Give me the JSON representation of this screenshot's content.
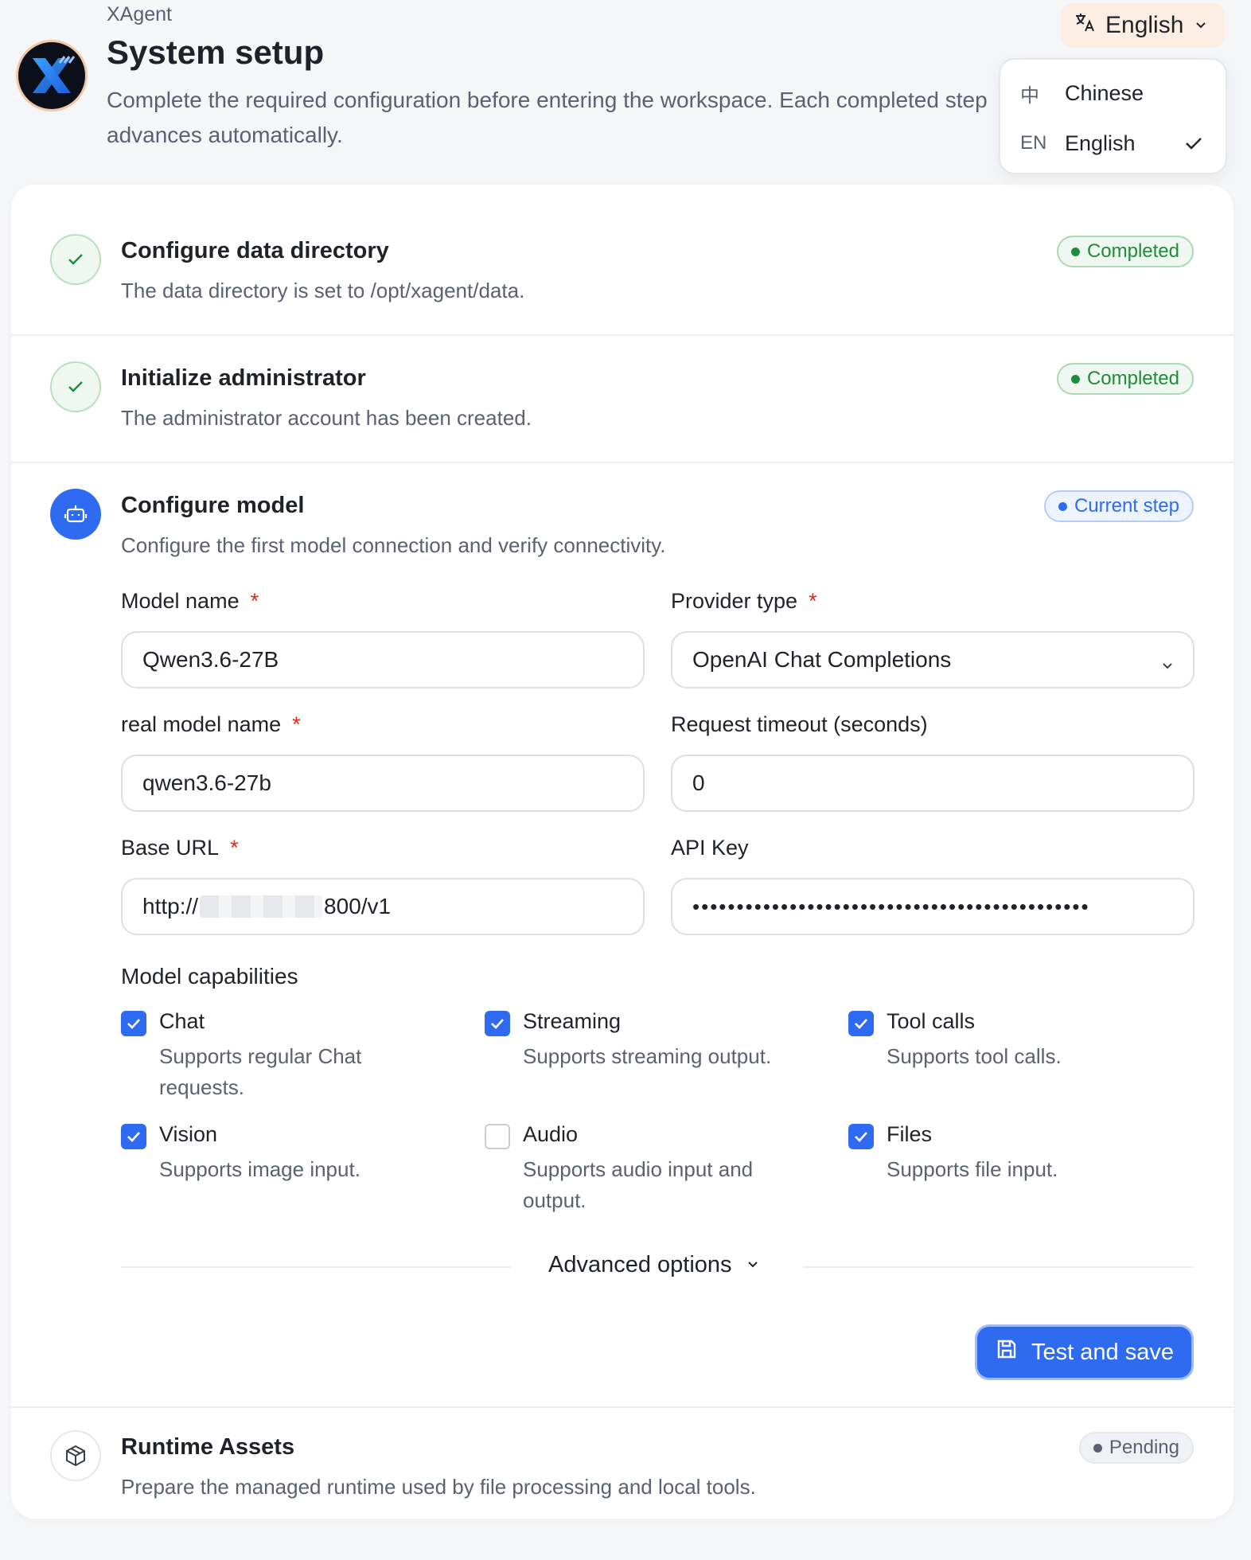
{
  "header": {
    "app_name": "XAgent",
    "title": "System setup",
    "subtitle": "Complete the required configuration before entering the workspace. Each completed step advances automatically."
  },
  "language": {
    "current": "English",
    "options": [
      {
        "code": "中",
        "name": "Chinese",
        "selected": false
      },
      {
        "code": "EN",
        "name": "English",
        "selected": true
      }
    ]
  },
  "steps": {
    "data_dir": {
      "title": "Configure data directory",
      "desc": "The data directory is set to /opt/xagent/data.",
      "status": "Completed"
    },
    "admin": {
      "title": "Initialize administrator",
      "desc": "The administrator account has been created.",
      "status": "Completed"
    },
    "model": {
      "title": "Configure model",
      "desc": "Configure the first model connection and verify connectivity.",
      "status": "Current step"
    },
    "runtime": {
      "title": "Runtime Assets",
      "desc": "Prepare the managed runtime used by file processing and local tools.",
      "status": "Pending"
    }
  },
  "form": {
    "model_name": {
      "label": "Model name",
      "value": "Qwen3.6-27B",
      "required": "*"
    },
    "provider_type": {
      "label": "Provider type",
      "value": "OpenAI Chat Completions",
      "required": "*"
    },
    "real_model_name": {
      "label": "real model name",
      "value": "qwen3.6-27b",
      "required": "*"
    },
    "timeout": {
      "label": "Request timeout (seconds)",
      "value": "0"
    },
    "base_url": {
      "label": "Base URL",
      "prefix": "http://",
      "suffix": "800/v1",
      "required": "*"
    },
    "api_key": {
      "label": "API Key",
      "value": "•••••••••••••••••••••••••••••••••••••••••••••"
    }
  },
  "capabilities": {
    "title": "Model capabilities",
    "items": [
      {
        "label": "Chat",
        "desc": "Supports regular Chat requests.",
        "checked": true
      },
      {
        "label": "Streaming",
        "desc": "Supports streaming output.",
        "checked": true
      },
      {
        "label": "Tool calls",
        "desc": "Supports tool calls.",
        "checked": true
      },
      {
        "label": "Vision",
        "desc": "Supports image input.",
        "checked": true
      },
      {
        "label": "Audio",
        "desc": "Supports audio input and output.",
        "checked": false
      },
      {
        "label": "Files",
        "desc": "Supports file input.",
        "checked": true
      }
    ]
  },
  "advanced_label": "Advanced options",
  "save_label": "Test and save",
  "colors": {
    "accent": "#2f6bf0",
    "success": "#1e8c3a",
    "required": "#e0281b"
  }
}
